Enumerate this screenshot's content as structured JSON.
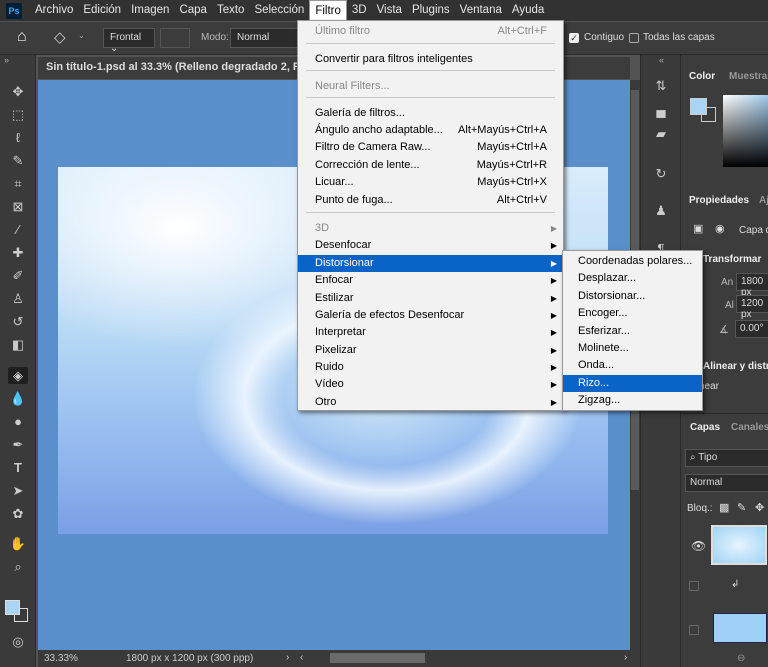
{
  "menubar": {
    "logo": "Ps",
    "items": [
      "Archivo",
      "Edición",
      "Imagen",
      "Capa",
      "Texto",
      "Selección",
      "Filtro",
      "3D",
      "Vista",
      "Plugins",
      "Ventana",
      "Ayuda"
    ],
    "active": "Filtro"
  },
  "options": {
    "mode_label": "Modo:",
    "mode_value": "Normal",
    "source": "Frontal",
    "contiguous": "Contiguo",
    "contiguous_checked": true,
    "all_layers": "Todas las capas",
    "all_layers_checked": false
  },
  "document": {
    "title": "Sin título-1.psd al 33.3% (Relleno degradado 2, RGB/8)",
    "zoom": "33.33%",
    "info": "1800 px x 1200 px (300 ppp)"
  },
  "filter_menu": {
    "items": [
      {
        "label": "Último filtro",
        "shortcut": "Alt+Ctrl+F",
        "disabled": true
      },
      {
        "label": "Convertir para filtros inteligentes"
      },
      {
        "label": "Neural Filters...",
        "disabled": true
      },
      {
        "label": "Galería de filtros..."
      },
      {
        "label": "Ángulo ancho adaptable...",
        "shortcut": "Alt+Mayús+Ctrl+A"
      },
      {
        "label": "Filtro de Camera Raw...",
        "shortcut": "Mayús+Ctrl+A"
      },
      {
        "label": "Corrección de lente...",
        "shortcut": "Mayús+Ctrl+R"
      },
      {
        "label": "Licuar...",
        "shortcut": "Mayús+Ctrl+X"
      },
      {
        "label": "Punto de fuga...",
        "shortcut": "Alt+Ctrl+V"
      },
      {
        "label": "3D",
        "disabled": true,
        "submenu": true
      },
      {
        "label": "Desenfocar",
        "submenu": true
      },
      {
        "label": "Distorsionar",
        "submenu": true,
        "highlighted": true
      },
      {
        "label": "Enfocar",
        "submenu": true
      },
      {
        "label": "Estilizar",
        "submenu": true
      },
      {
        "label": "Galería de efectos Desenfocar",
        "submenu": true
      },
      {
        "label": "Interpretar",
        "submenu": true
      },
      {
        "label": "Pixelizar",
        "submenu": true
      },
      {
        "label": "Ruido",
        "submenu": true
      },
      {
        "label": "Vídeo",
        "submenu": true
      },
      {
        "label": "Otro",
        "submenu": true
      }
    ]
  },
  "distort_submenu": {
    "items": [
      "Coordenadas polares...",
      "Desplazar...",
      "Distorsionar...",
      "Encoger...",
      "Esferizar...",
      "Molinete...",
      "Onda...",
      "Rizo...",
      "Zigzag..."
    ],
    "highlighted": "Rizo..."
  },
  "right_panel": {
    "color_tabs": [
      "Color",
      "Muestras"
    ],
    "properties_tabs": [
      "Propiedades",
      "Ajustes"
    ],
    "layer_type": "Capa de",
    "transform_title": "Transformar",
    "width_label": "An",
    "width_value": "1800 px",
    "height_label": "Al",
    "height_value": "1200 px",
    "angle_value": "0.00°",
    "align_title": "Alinear y distribuir",
    "align_label": "Alinear:",
    "layers_tabs": [
      "Capas",
      "Canales"
    ],
    "layer_filter": "Tipo",
    "blend_mode": "Normal",
    "lock_label": "Bloq.:"
  },
  "colors": {
    "foreground": "#a8d4f5",
    "background": "#3a3a3a",
    "canvas_bg": "#5b8fcb",
    "highlight": "#0a64c8"
  }
}
